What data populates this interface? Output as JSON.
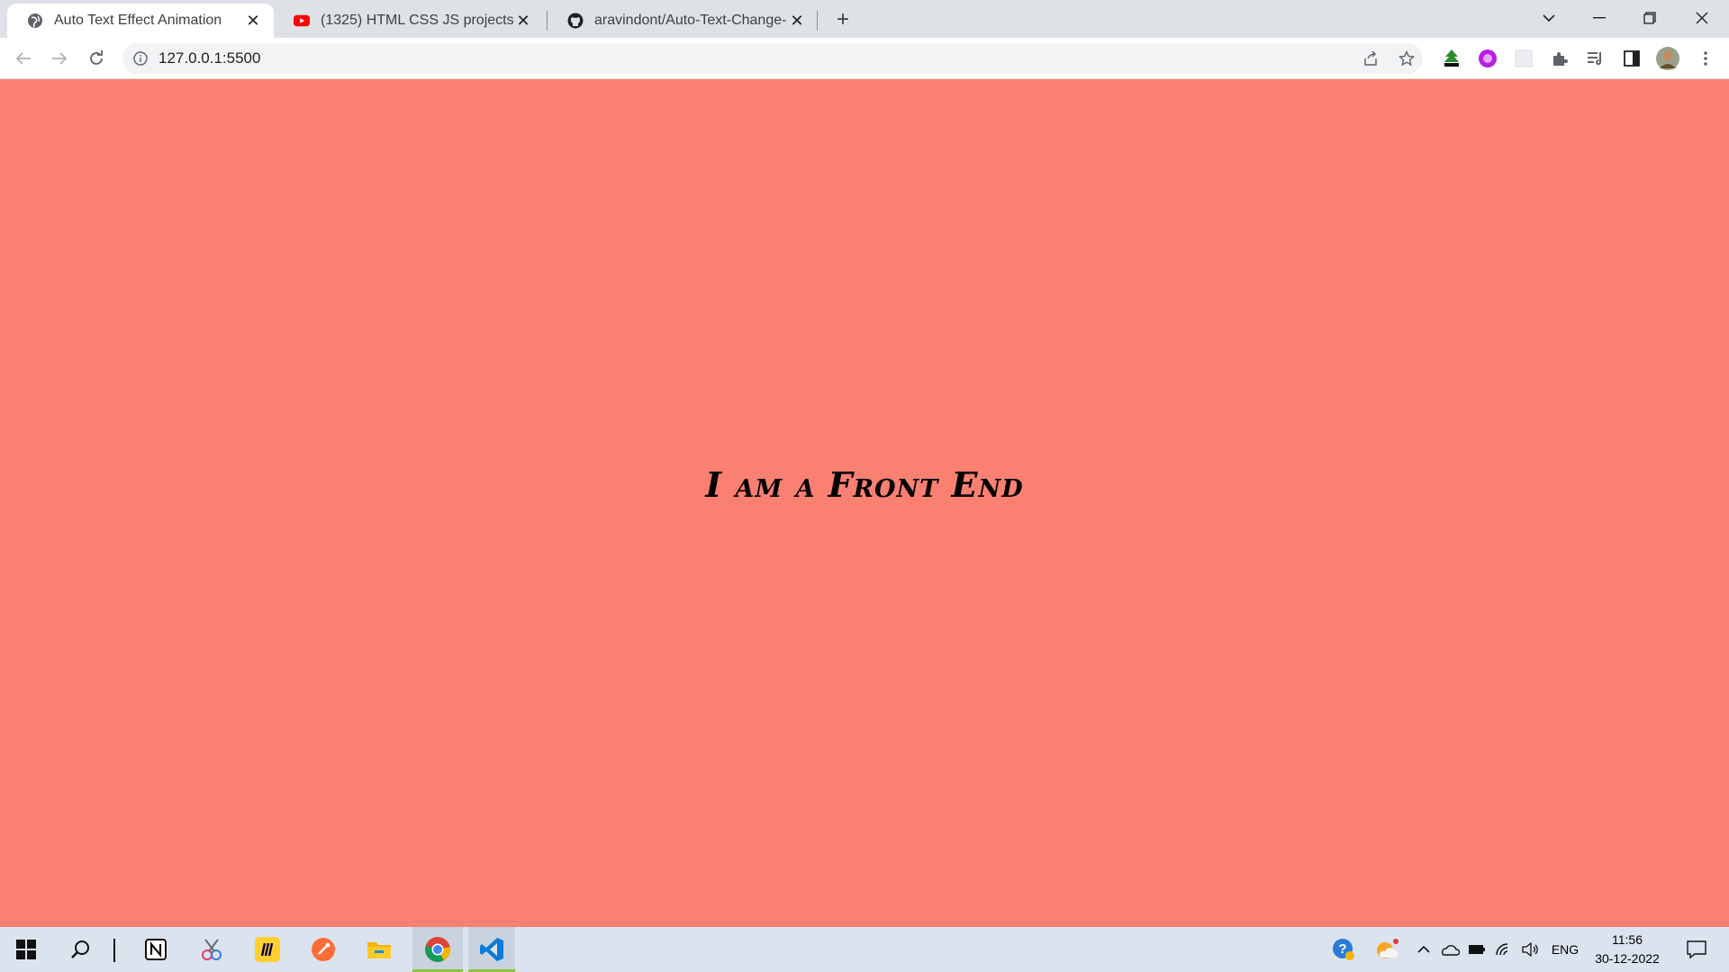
{
  "browser": {
    "tabs": [
      {
        "title": "Auto Text Effect Animation",
        "favicon": "globe-icon",
        "active": true
      },
      {
        "title": "(1325) HTML CSS JS projects (Beg",
        "favicon": "youtube-icon",
        "active": false
      },
      {
        "title": "aravindont/Auto-Text-Change-An",
        "favicon": "github-icon",
        "active": false
      }
    ],
    "url": "127.0.0.1:5500"
  },
  "page": {
    "headline": "I am a Front End",
    "background_color": "#fa8072"
  },
  "taskbar": {
    "apps": [
      "windows-start-icon",
      "search-icon",
      "notion-icon",
      "snip-sketch-icon",
      "miro-icon",
      "postman-icon",
      "file-explorer-icon",
      "chrome-icon",
      "vscode-icon"
    ],
    "tray": {
      "language": "ENG",
      "time": "11:56",
      "date": "30-12-2022"
    }
  }
}
